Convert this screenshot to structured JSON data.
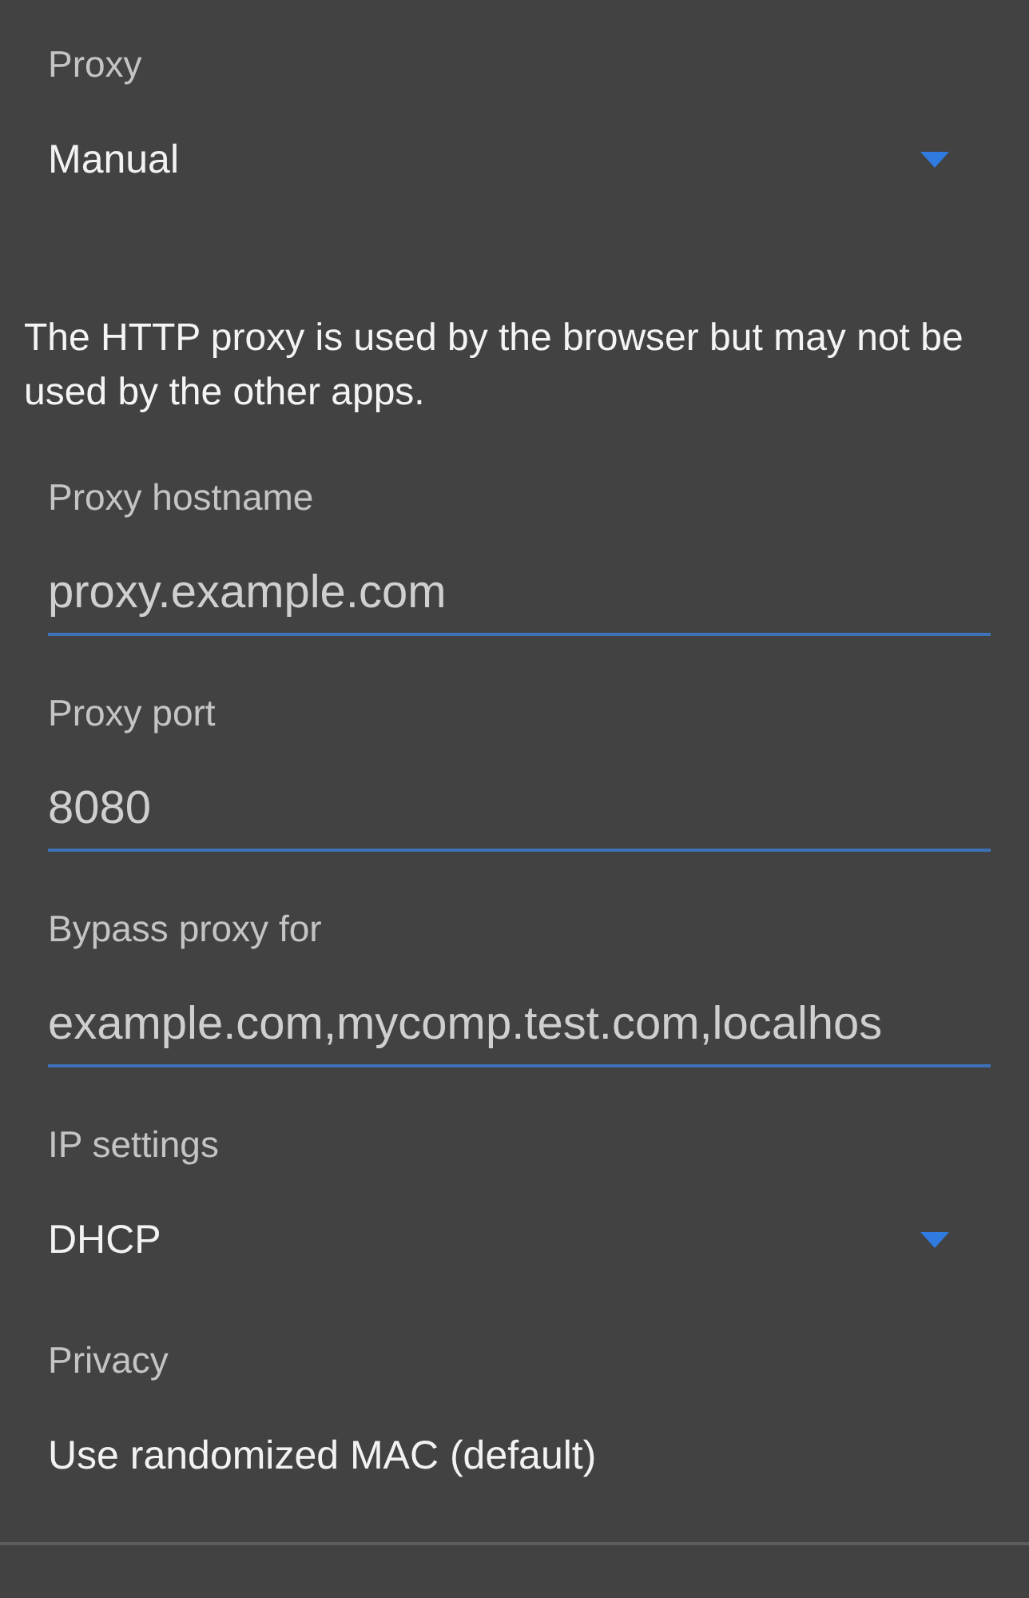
{
  "sections": [
    {
      "kind": "dropdown",
      "label": "Proxy",
      "value": "Manual"
    },
    {
      "kind": "note",
      "text": "The HTTP proxy is used by the browser but may not be used by the other apps."
    },
    {
      "kind": "field",
      "label": "Proxy hostname",
      "placeholder": "proxy.example.com"
    },
    {
      "kind": "field",
      "label": "Proxy port",
      "placeholder": "8080"
    },
    {
      "kind": "field",
      "label": "Bypass proxy for",
      "placeholder": "example.com,mycomp.test.com,localhos"
    },
    {
      "kind": "dropdown",
      "label": "IP settings",
      "value": "DHCP"
    },
    {
      "kind": "option",
      "label": "Privacy",
      "value": "Use randomized MAC (default)"
    }
  ]
}
